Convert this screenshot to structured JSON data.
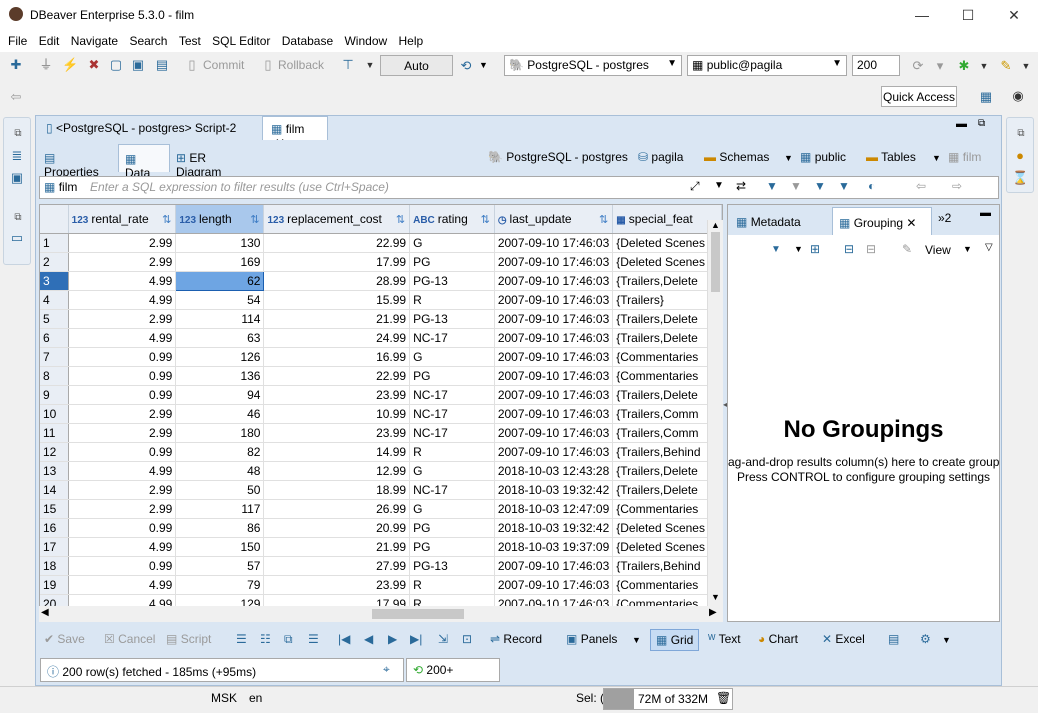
{
  "window": {
    "title": "DBeaver Enterprise 5.3.0 - film",
    "minimize": "—",
    "maximize": "☐",
    "close": "✕"
  },
  "menu": [
    "File",
    "Edit",
    "Navigate",
    "Search",
    "Test",
    "SQL Editor",
    "Database",
    "Window",
    "Help"
  ],
  "toolbar": {
    "commit": "Commit",
    "rollback": "Rollback",
    "txn_mode": "Auto",
    "datasource": "PostgreSQL - postgres",
    "schema": "public@pagila",
    "fetch_size": "200",
    "quick_access": "Quick Access"
  },
  "editor_tabs": [
    {
      "label": "<PostgreSQL - postgres> Script-2"
    },
    {
      "label": "film"
    }
  ],
  "sub_tabs": [
    "Properties",
    "Data",
    "ER Diagram"
  ],
  "nav": {
    "connection": "PostgreSQL - postgres",
    "database": "pagila",
    "schemas": "Schemas",
    "schema": "public",
    "tables": "Tables",
    "table": "film"
  },
  "filter": {
    "entity": "film",
    "placeholder": "Enter a SQL expression to filter results (use Ctrl+Space)"
  },
  "grid": {
    "columns": [
      {
        "name": "rental_rate",
        "type": "123"
      },
      {
        "name": "length",
        "type": "123"
      },
      {
        "name": "replacement_cost",
        "type": "123"
      },
      {
        "name": "rating",
        "type": "ABC"
      },
      {
        "name": "last_update",
        "type": "clock"
      },
      {
        "name": "special_feat",
        "type": "grid"
      }
    ],
    "rows": [
      [
        "1",
        "2.99",
        "130",
        "22.99",
        "G",
        "2007-09-10 17:46:03",
        "{Deleted Scenes"
      ],
      [
        "2",
        "2.99",
        "169",
        "17.99",
        "PG",
        "2007-09-10 17:46:03",
        "{Deleted Scenes"
      ],
      [
        "3",
        "4.99",
        "62",
        "28.99",
        "PG-13",
        "2007-09-10 17:46:03",
        "{Trailers,Delete"
      ],
      [
        "4",
        "4.99",
        "54",
        "15.99",
        "R",
        "2007-09-10 17:46:03",
        "{Trailers}"
      ],
      [
        "5",
        "2.99",
        "114",
        "21.99",
        "PG-13",
        "2007-09-10 17:46:03",
        "{Trailers,Delete"
      ],
      [
        "6",
        "4.99",
        "63",
        "24.99",
        "NC-17",
        "2007-09-10 17:46:03",
        "{Trailers,Delete"
      ],
      [
        "7",
        "0.99",
        "126",
        "16.99",
        "G",
        "2007-09-10 17:46:03",
        "{Commentaries"
      ],
      [
        "8",
        "0.99",
        "136",
        "22.99",
        "PG",
        "2007-09-10 17:46:03",
        "{Commentaries"
      ],
      [
        "9",
        "0.99",
        "94",
        "23.99",
        "NC-17",
        "2007-09-10 17:46:03",
        "{Trailers,Delete"
      ],
      [
        "10",
        "2.99",
        "46",
        "10.99",
        "NC-17",
        "2007-09-10 17:46:03",
        "{Trailers,Comm"
      ],
      [
        "11",
        "2.99",
        "180",
        "23.99",
        "NC-17",
        "2007-09-10 17:46:03",
        "{Trailers,Comm"
      ],
      [
        "12",
        "0.99",
        "82",
        "14.99",
        "R",
        "2007-09-10 17:46:03",
        "{Trailers,Behind"
      ],
      [
        "13",
        "4.99",
        "48",
        "12.99",
        "G",
        "2018-10-03 12:43:28",
        "{Trailers,Delete"
      ],
      [
        "14",
        "2.99",
        "50",
        "18.99",
        "NC-17",
        "2018-10-03 19:32:42",
        "{Trailers,Delete"
      ],
      [
        "15",
        "2.99",
        "117",
        "26.99",
        "G",
        "2018-10-03 12:47:09",
        "{Commentaries"
      ],
      [
        "16",
        "0.99",
        "86",
        "20.99",
        "PG",
        "2018-10-03 19:32:42",
        "{Deleted Scenes"
      ],
      [
        "17",
        "4.99",
        "150",
        "21.99",
        "PG",
        "2018-10-03 19:37:09",
        "{Deleted Scenes"
      ],
      [
        "18",
        "0.99",
        "57",
        "27.99",
        "PG-13",
        "2007-09-10 17:46:03",
        "{Trailers,Behind"
      ],
      [
        "19",
        "4.99",
        "79",
        "23.99",
        "R",
        "2007-09-10 17:46:03",
        "{Commentaries"
      ],
      [
        "20",
        "4.99",
        "129",
        "17.99",
        "R",
        "2007-09-10 17:46:03",
        "{Commentaries"
      ]
    ],
    "selected_row": "3"
  },
  "right_panel": {
    "tabs": [
      "Metadata",
      "Grouping"
    ],
    "overflow": "»2",
    "view_label": "View",
    "title": "No Groupings",
    "hint1": "ag-and-drop results column(s) here to create group",
    "hint2": "Press CONTROL to configure grouping settings"
  },
  "bottom_toolbar": {
    "save": "Save",
    "cancel": "Cancel",
    "script": "Script",
    "record": "Record",
    "panels": "Panels",
    "grid": "Grid",
    "text": "Text",
    "chart": "Chart",
    "excel": "Excel"
  },
  "status": {
    "fetched": "200 row(s) fetched - 185ms (+95ms)",
    "count": "200+"
  },
  "footer": {
    "tz": "MSK",
    "lang": "en",
    "sel": "Sel: (",
    "memory": "72M of 332M"
  }
}
